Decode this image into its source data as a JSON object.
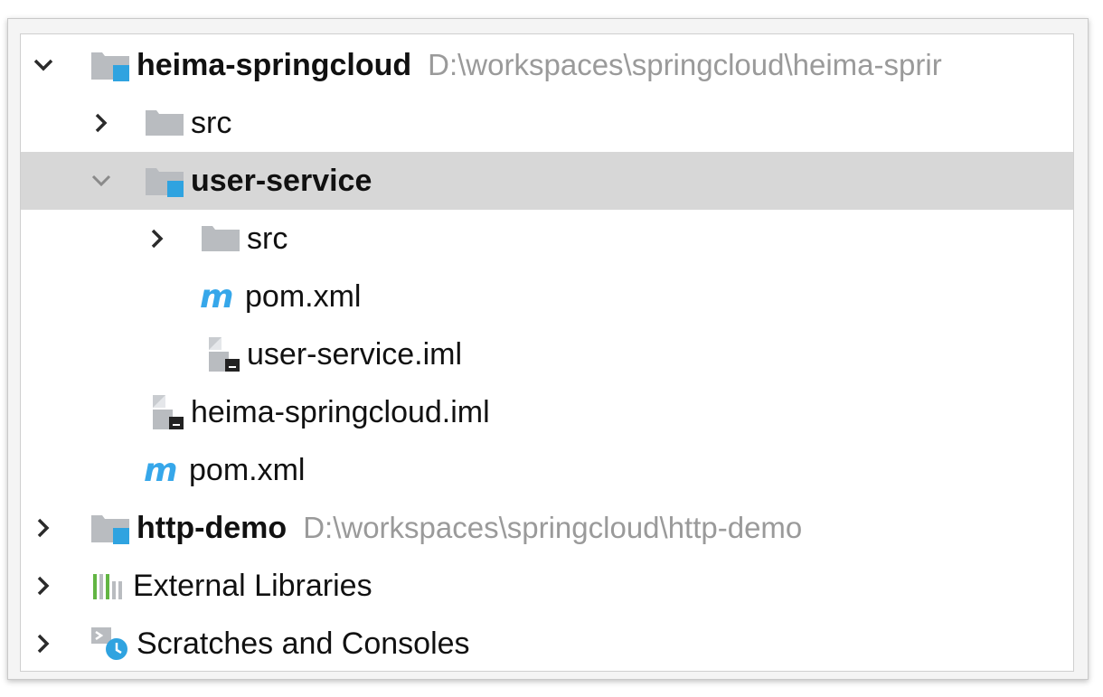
{
  "tree": [
    {
      "label": "heima-springcloud",
      "path": "D:\\workspaces\\springcloud\\heima-sprir",
      "icon": "module-folder-icon",
      "expanded": true,
      "bold": true
    },
    {
      "label": "src",
      "icon": "folder-icon",
      "expanded": false
    },
    {
      "label": "user-service",
      "icon": "module-folder-icon",
      "expanded": true,
      "bold": true,
      "selected": true
    },
    {
      "label": "src",
      "icon": "folder-icon",
      "expanded": false
    },
    {
      "label": "pom.xml",
      "icon": "maven-icon"
    },
    {
      "label": "user-service.iml",
      "icon": "iml-file-icon"
    },
    {
      "label": "heima-springcloud.iml",
      "icon": "iml-file-icon"
    },
    {
      "label": "pom.xml",
      "icon": "maven-icon"
    },
    {
      "label": "http-demo",
      "path": "D:\\workspaces\\springcloud\\http-demo",
      "icon": "module-folder-icon",
      "expanded": false,
      "bold": true
    },
    {
      "label": "External Libraries",
      "icon": "libraries-icon",
      "expanded": false
    },
    {
      "label": "Scratches and Consoles",
      "icon": "scratches-icon",
      "expanded": false
    }
  ],
  "colors": {
    "selection": "#d7d7d7",
    "folder": "#b9bcc0",
    "module_marker": "#2fa3e0",
    "maven": "#36a7ea",
    "path_text": "#9a9a9a"
  }
}
